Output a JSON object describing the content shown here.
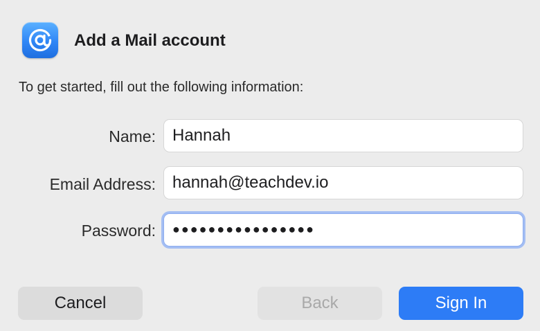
{
  "dialog": {
    "title": "Add a Mail account",
    "subtitle": "To get started, fill out the following information:",
    "app_icon": "at-sign-icon"
  },
  "form": {
    "name_label": "Name:",
    "name_value": "Hannah",
    "email_label": "Email Address:",
    "email_value": "hannah@teachdev.io",
    "password_label": "Password:",
    "password_value": "●●●●●●●●●●●●●●●●"
  },
  "buttons": {
    "cancel_label": "Cancel",
    "back_label": "Back",
    "back_enabled": false,
    "signin_label": "Sign In"
  },
  "colors": {
    "accent": "#2d7cf6",
    "focus_ring": "#a4bef3",
    "background": "#ececec"
  }
}
